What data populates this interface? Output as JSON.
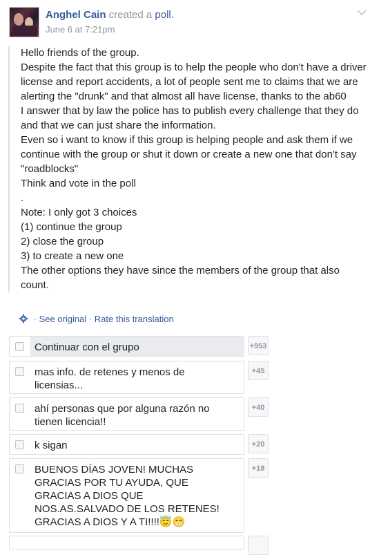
{
  "post": {
    "author": "Anghel Cain",
    "action": " created a ",
    "object": "poll.",
    "date": "June 6 at 7:21pm"
  },
  "body_lines": [
    "Hello friends of the group.",
    "Despite the fact that this group is to help the people who don't have a driver license and report accidents, a lot of people sent me to claims that we are alerting the \"drunk\" and that almost all have license, thanks to the ab60",
    "I answer that by law the police has to publish every challenge that they do and that we can just share the information.",
    "Even so i want to know if this group is helping people and ask them if we continue with the group or shut it down or create a new one that don't say \"roadblocks\"",
    "Think and vote in the poll",
    ".",
    "Note: I only got 3 choices",
    "(1) continue the group",
    "2) close the group",
    "3) to create a new one",
    "The other options they have since the members of the group that also count."
  ],
  "translation": {
    "see_original": "See original",
    "separator": " · ",
    "rate": "Rate this translation"
  },
  "poll_options": [
    {
      "label": "Continuar con el grupo",
      "count": "+953",
      "fill": 1.0
    },
    {
      "label": "mas info. de retenes y menos de\nlicensias...",
      "count": "+45",
      "fill": 0.0
    },
    {
      "label": "ahí personas que por alguna razón no\ntienen licencia!!",
      "count": "+40",
      "fill": 0.0
    },
    {
      "label": "k sigan",
      "count": "+20",
      "fill": 0.0
    },
    {
      "label": "BUENOS DÍAS JOVEN! MUCHAS\nGRACIAS POR TU AYUDA, QUE\nGRACIAS A DIOS QUE\nNOS.AS.SALVADO DE LOS RETENES!\nGRACIAS A DIOS Y A TI!!!!😇😁",
      "count": "+18",
      "fill": 0.0
    }
  ],
  "colors": {
    "link": "#365899",
    "muted": "#90949c",
    "text": "#1d2129",
    "border": "#dddfe2"
  }
}
